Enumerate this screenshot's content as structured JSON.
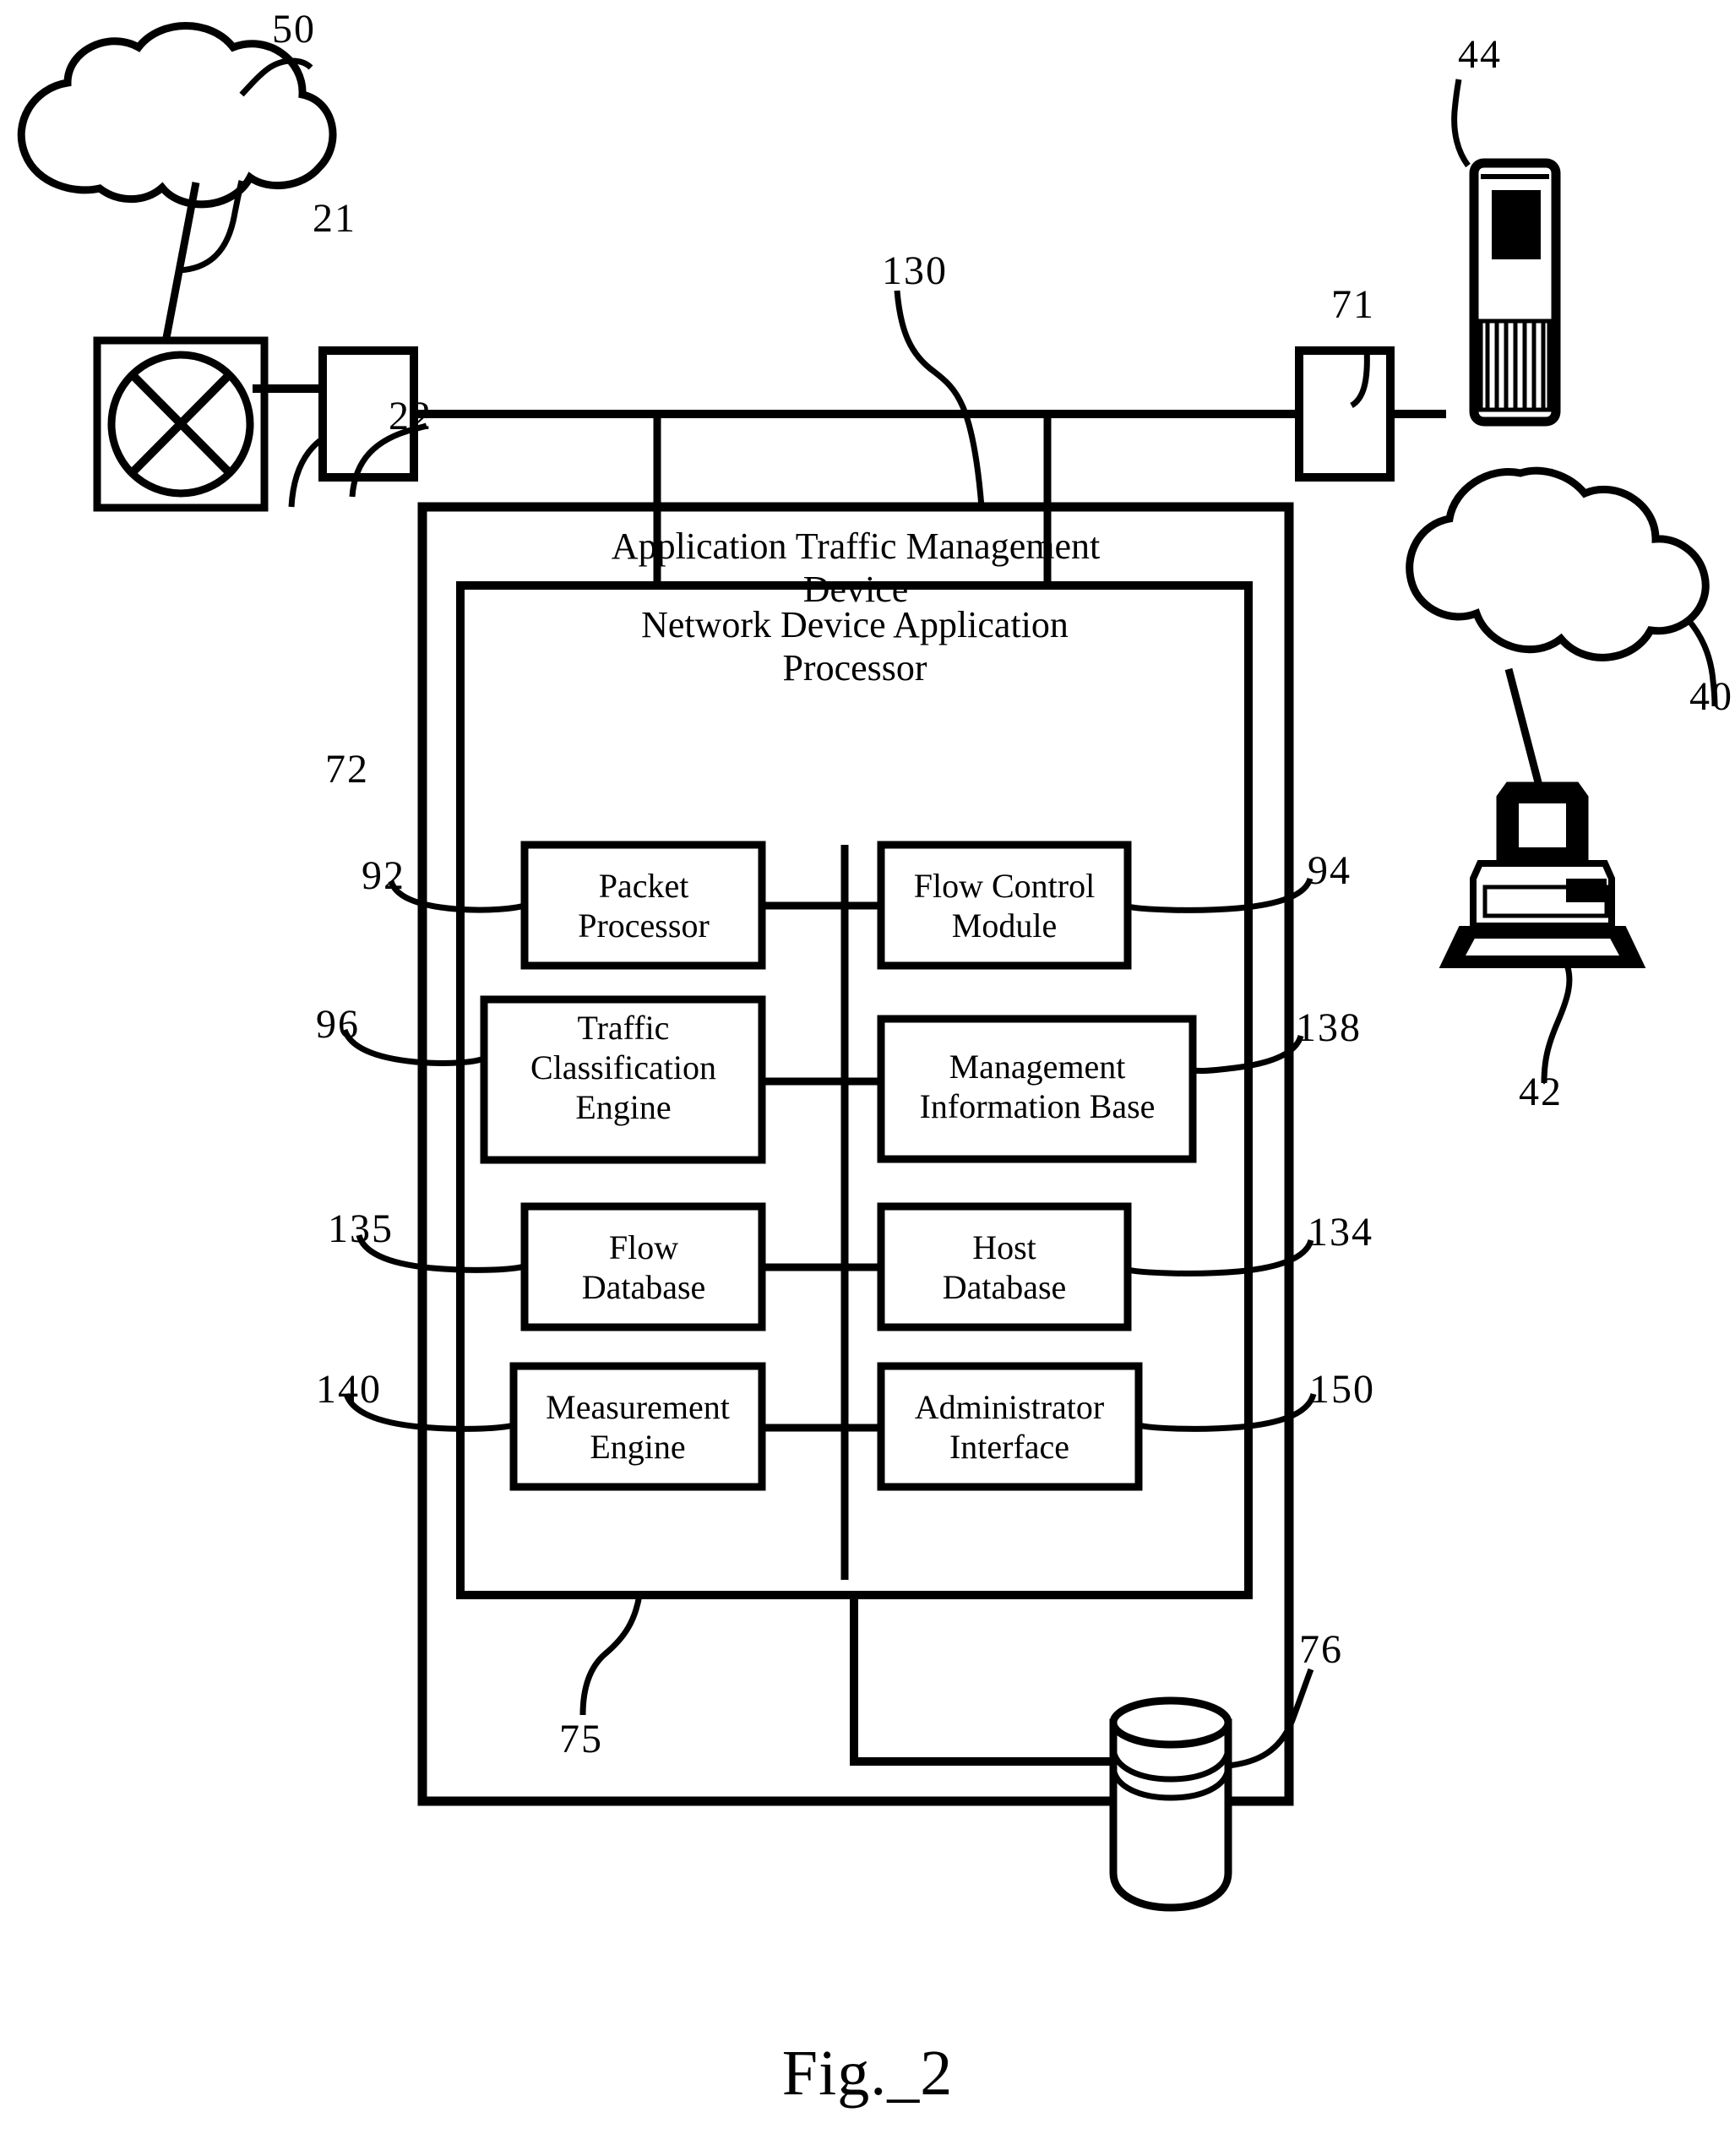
{
  "figure": {
    "caption": "Fig._2",
    "type": "patent-block-diagram"
  },
  "outer_device": {
    "title_line1": "Application Traffic Management",
    "title_line2": "Device",
    "ref": "130"
  },
  "processor": {
    "title_line1": "Network Device Application",
    "title_line2": "Processor",
    "ref": "75"
  },
  "modules": [
    {
      "line1": "Packet",
      "line2": "Processor",
      "ref": "92",
      "ref_side": "left"
    },
    {
      "line1": "Flow Control",
      "line2": "Module",
      "ref": "94",
      "ref_side": "right"
    },
    {
      "line1": "Traffic",
      "line2": "Classification",
      "line3": "Engine",
      "ref": "96",
      "ref_side": "left"
    },
    {
      "line1": "Management",
      "line2": "Information Base",
      "ref": "138",
      "ref_side": "right"
    },
    {
      "line1": "Flow",
      "line2": "Database",
      "ref": "135",
      "ref_side": "left"
    },
    {
      "line1": "Host",
      "line2": "Database",
      "ref": "134",
      "ref_side": "right"
    },
    {
      "line1": "Measurement",
      "line2": "Engine",
      "ref": "140",
      "ref_side": "left"
    },
    {
      "line1": "Administrator",
      "line2": "Interface",
      "ref": "150",
      "ref_side": "right"
    }
  ],
  "network_elements": {
    "left_cloud_ref": "50",
    "left_link_ref": "21",
    "router_ref": "22",
    "left_interface_ref": "72",
    "right_interface_ref": "71",
    "right_cloud_ref": "40",
    "server_ref": "44",
    "client_ref": "42",
    "persistent_store_ref": "76"
  },
  "icons": {
    "left_cloud": "cloud-icon",
    "right_cloud": "cloud-icon",
    "router": "router-crossed-circle-icon",
    "server": "server-tower-icon",
    "client": "desktop-computer-icon",
    "datastore": "database-cylinder-icon"
  },
  "colors": {
    "ink": "#000000",
    "paper": "#ffffff"
  }
}
